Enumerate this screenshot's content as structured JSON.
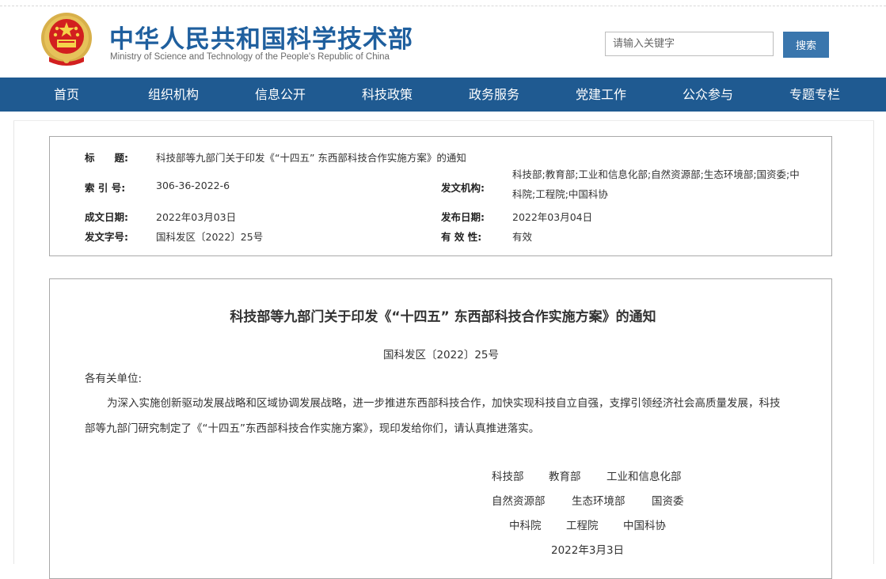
{
  "header": {
    "title": "中华人民共和国科学技术部",
    "subtitle": "Ministry of Science and Technology of the People's Republic of China",
    "emblem_icon": "national-emblem-icon"
  },
  "search": {
    "placeholder": "请输入关键字",
    "button_label": "搜索"
  },
  "nav": {
    "items": [
      {
        "label": "首页"
      },
      {
        "label": "组织机构"
      },
      {
        "label": "信息公开"
      },
      {
        "label": "科技政策"
      },
      {
        "label": "政务服务"
      },
      {
        "label": "党建工作"
      },
      {
        "label": "公众参与"
      },
      {
        "label": "专题专栏"
      }
    ]
  },
  "meta": {
    "title_label": "标　　题:",
    "title_value": "科技部等九部门关于印发《“十四五” 东西部科技合作实施方案》的通知",
    "index_label": "索 引 号:",
    "index_value": "306-36-2022-6",
    "issuer_label": "发文机构:",
    "issuer_value": "科技部;教育部;工业和信息化部;自然资源部;生态环境部;国资委;中科院;工程院;中国科协",
    "created_label": "成文日期:",
    "created_value": "2022年03月03日",
    "published_label": "发布日期:",
    "published_value": "2022年03月04日",
    "docno_label": "发文字号:",
    "docno_value": "国科发区〔2022〕25号",
    "validity_label": "有 效 性:",
    "validity_value": "有效"
  },
  "article": {
    "title": "科技部等九部门关于印发《“十四五” 东西部科技合作实施方案》的通知",
    "doc_number": "国科发区〔2022〕25号",
    "salutation": "各有关单位:",
    "paragraph": "为深入实施创新驱动发展战略和区域协调发展战略，进一步推进东西部科技合作，加快实现科技自立自强，支撑引领经济社会高质量发展，科技部等九部门研究制定了《“十四五”东西部科技合作实施方案》，现印发给你们，请认真推进落实。",
    "signatories": [
      [
        "科技部",
        "教育部",
        "工业和信息化部"
      ],
      [
        "自然资源部",
        "生态环境部",
        "国资委"
      ],
      [
        "中科院",
        "工程院",
        "中国科协"
      ]
    ],
    "date": "2022年3月3日"
  },
  "colors": {
    "nav_bg": "#1f5a91",
    "title_blue": "#1f5f9e",
    "search_button": "#3a76ad"
  }
}
